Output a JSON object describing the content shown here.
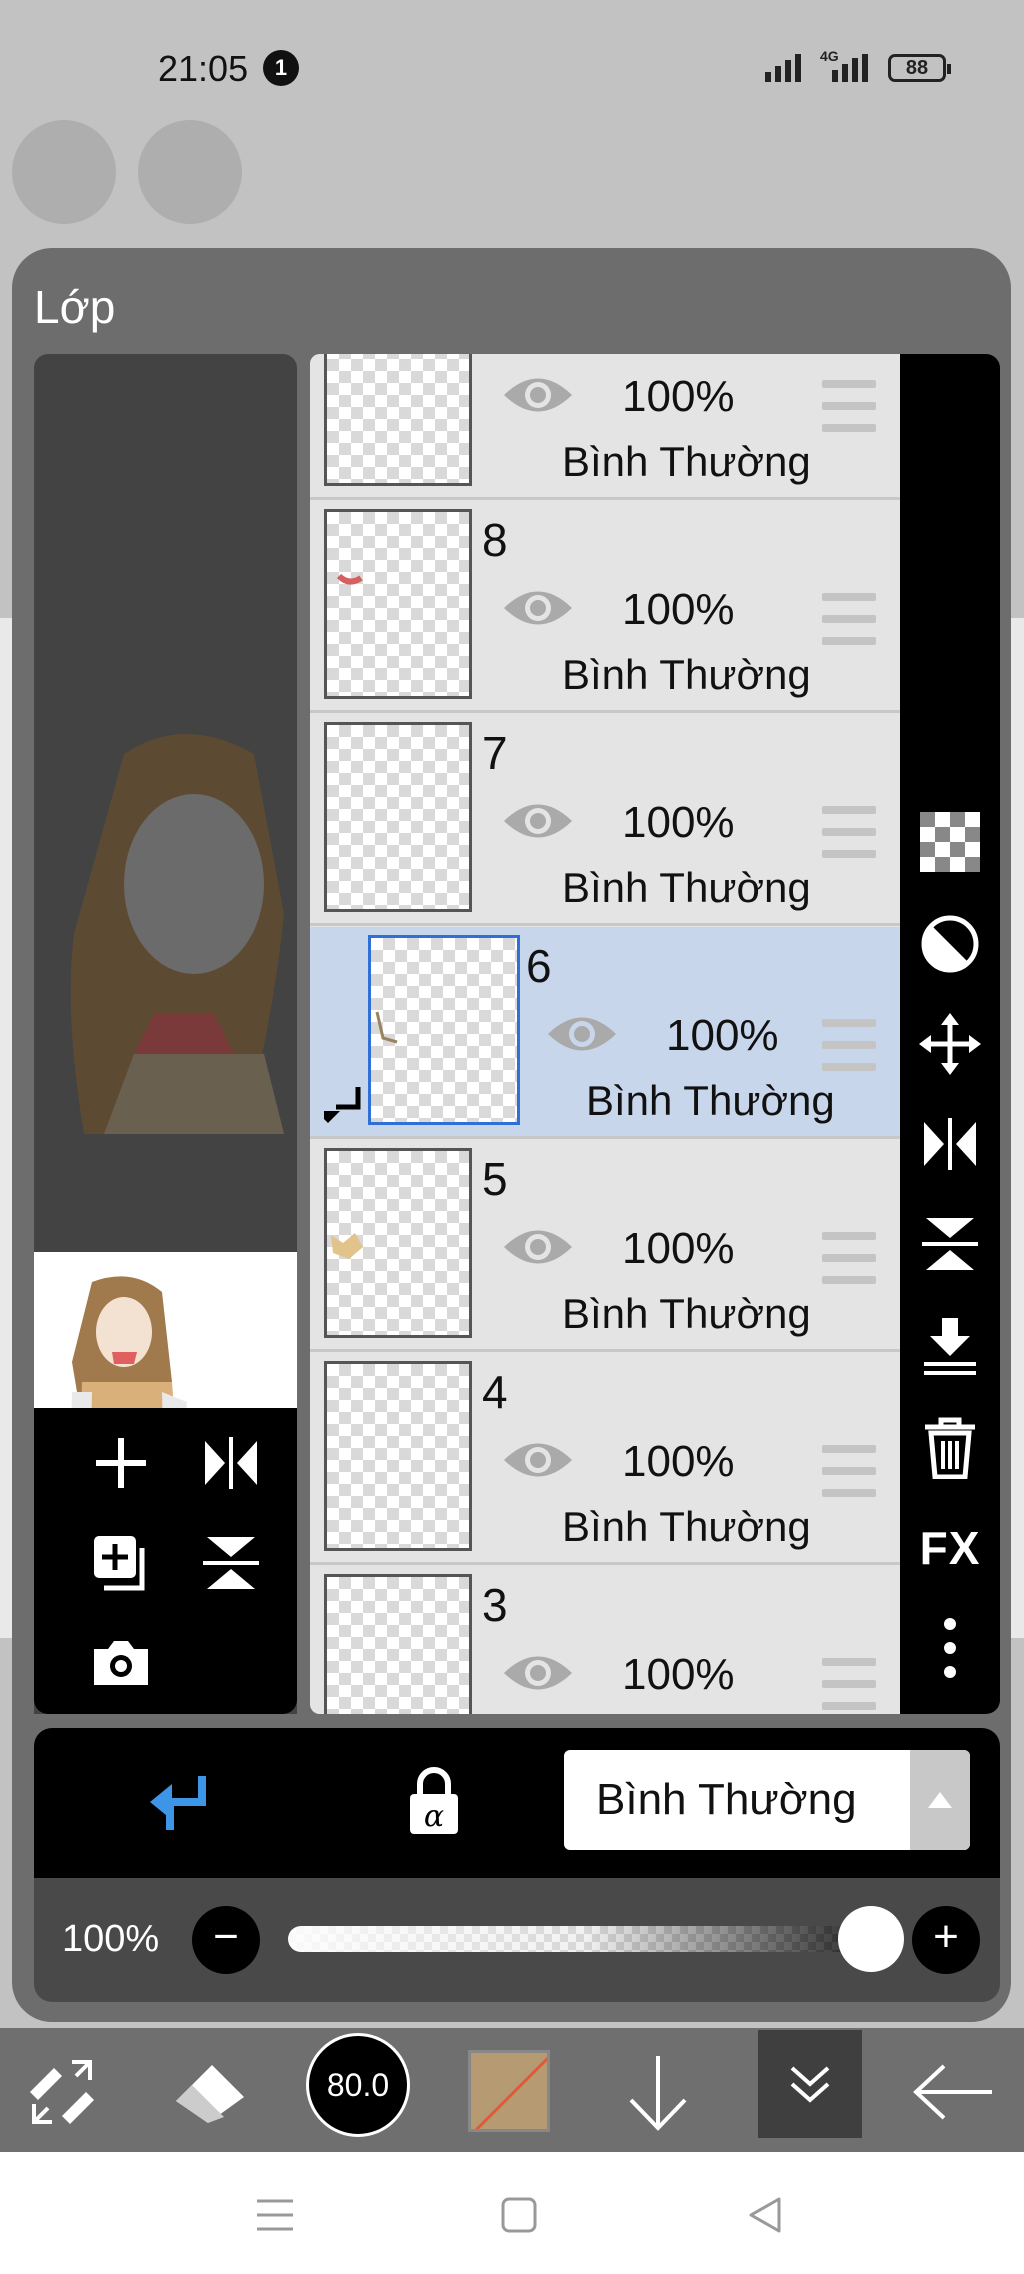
{
  "status_bar": {
    "time": "21:05",
    "notification_count": "1",
    "network": "4G",
    "battery": "88"
  },
  "panel": {
    "title": "Lớp"
  },
  "layers": [
    {
      "number": "",
      "opacity": "100%",
      "blend": "Bình Thường",
      "selected": false,
      "clipped": false
    },
    {
      "number": "8",
      "opacity": "100%",
      "blend": "Bình Thường",
      "selected": false,
      "clipped": false
    },
    {
      "number": "7",
      "opacity": "100%",
      "blend": "Bình Thường",
      "selected": false,
      "clipped": false
    },
    {
      "number": "6",
      "opacity": "100%",
      "blend": "Bình Thường",
      "selected": true,
      "clipped": true
    },
    {
      "number": "5",
      "opacity": "100%",
      "blend": "Bình Thường",
      "selected": false,
      "clipped": false
    },
    {
      "number": "4",
      "opacity": "100%",
      "blend": "Bình Thường",
      "selected": false,
      "clipped": false
    },
    {
      "number": "3",
      "opacity": "100%",
      "blend": "",
      "selected": false,
      "clipped": false
    }
  ],
  "right_tools": {
    "fx_label": "FX"
  },
  "controls": {
    "blend_mode": "Bình Thường",
    "opacity_value": "100%",
    "opacity_level": 1.0,
    "minus": "−",
    "plus": "+"
  },
  "toolbar": {
    "brush_size": "80.0",
    "color": "#b59a72"
  },
  "colors": {
    "panel": "#6d6d6d",
    "selected_row": "#c8d6ec",
    "accent_blue": "#3d95e8"
  }
}
